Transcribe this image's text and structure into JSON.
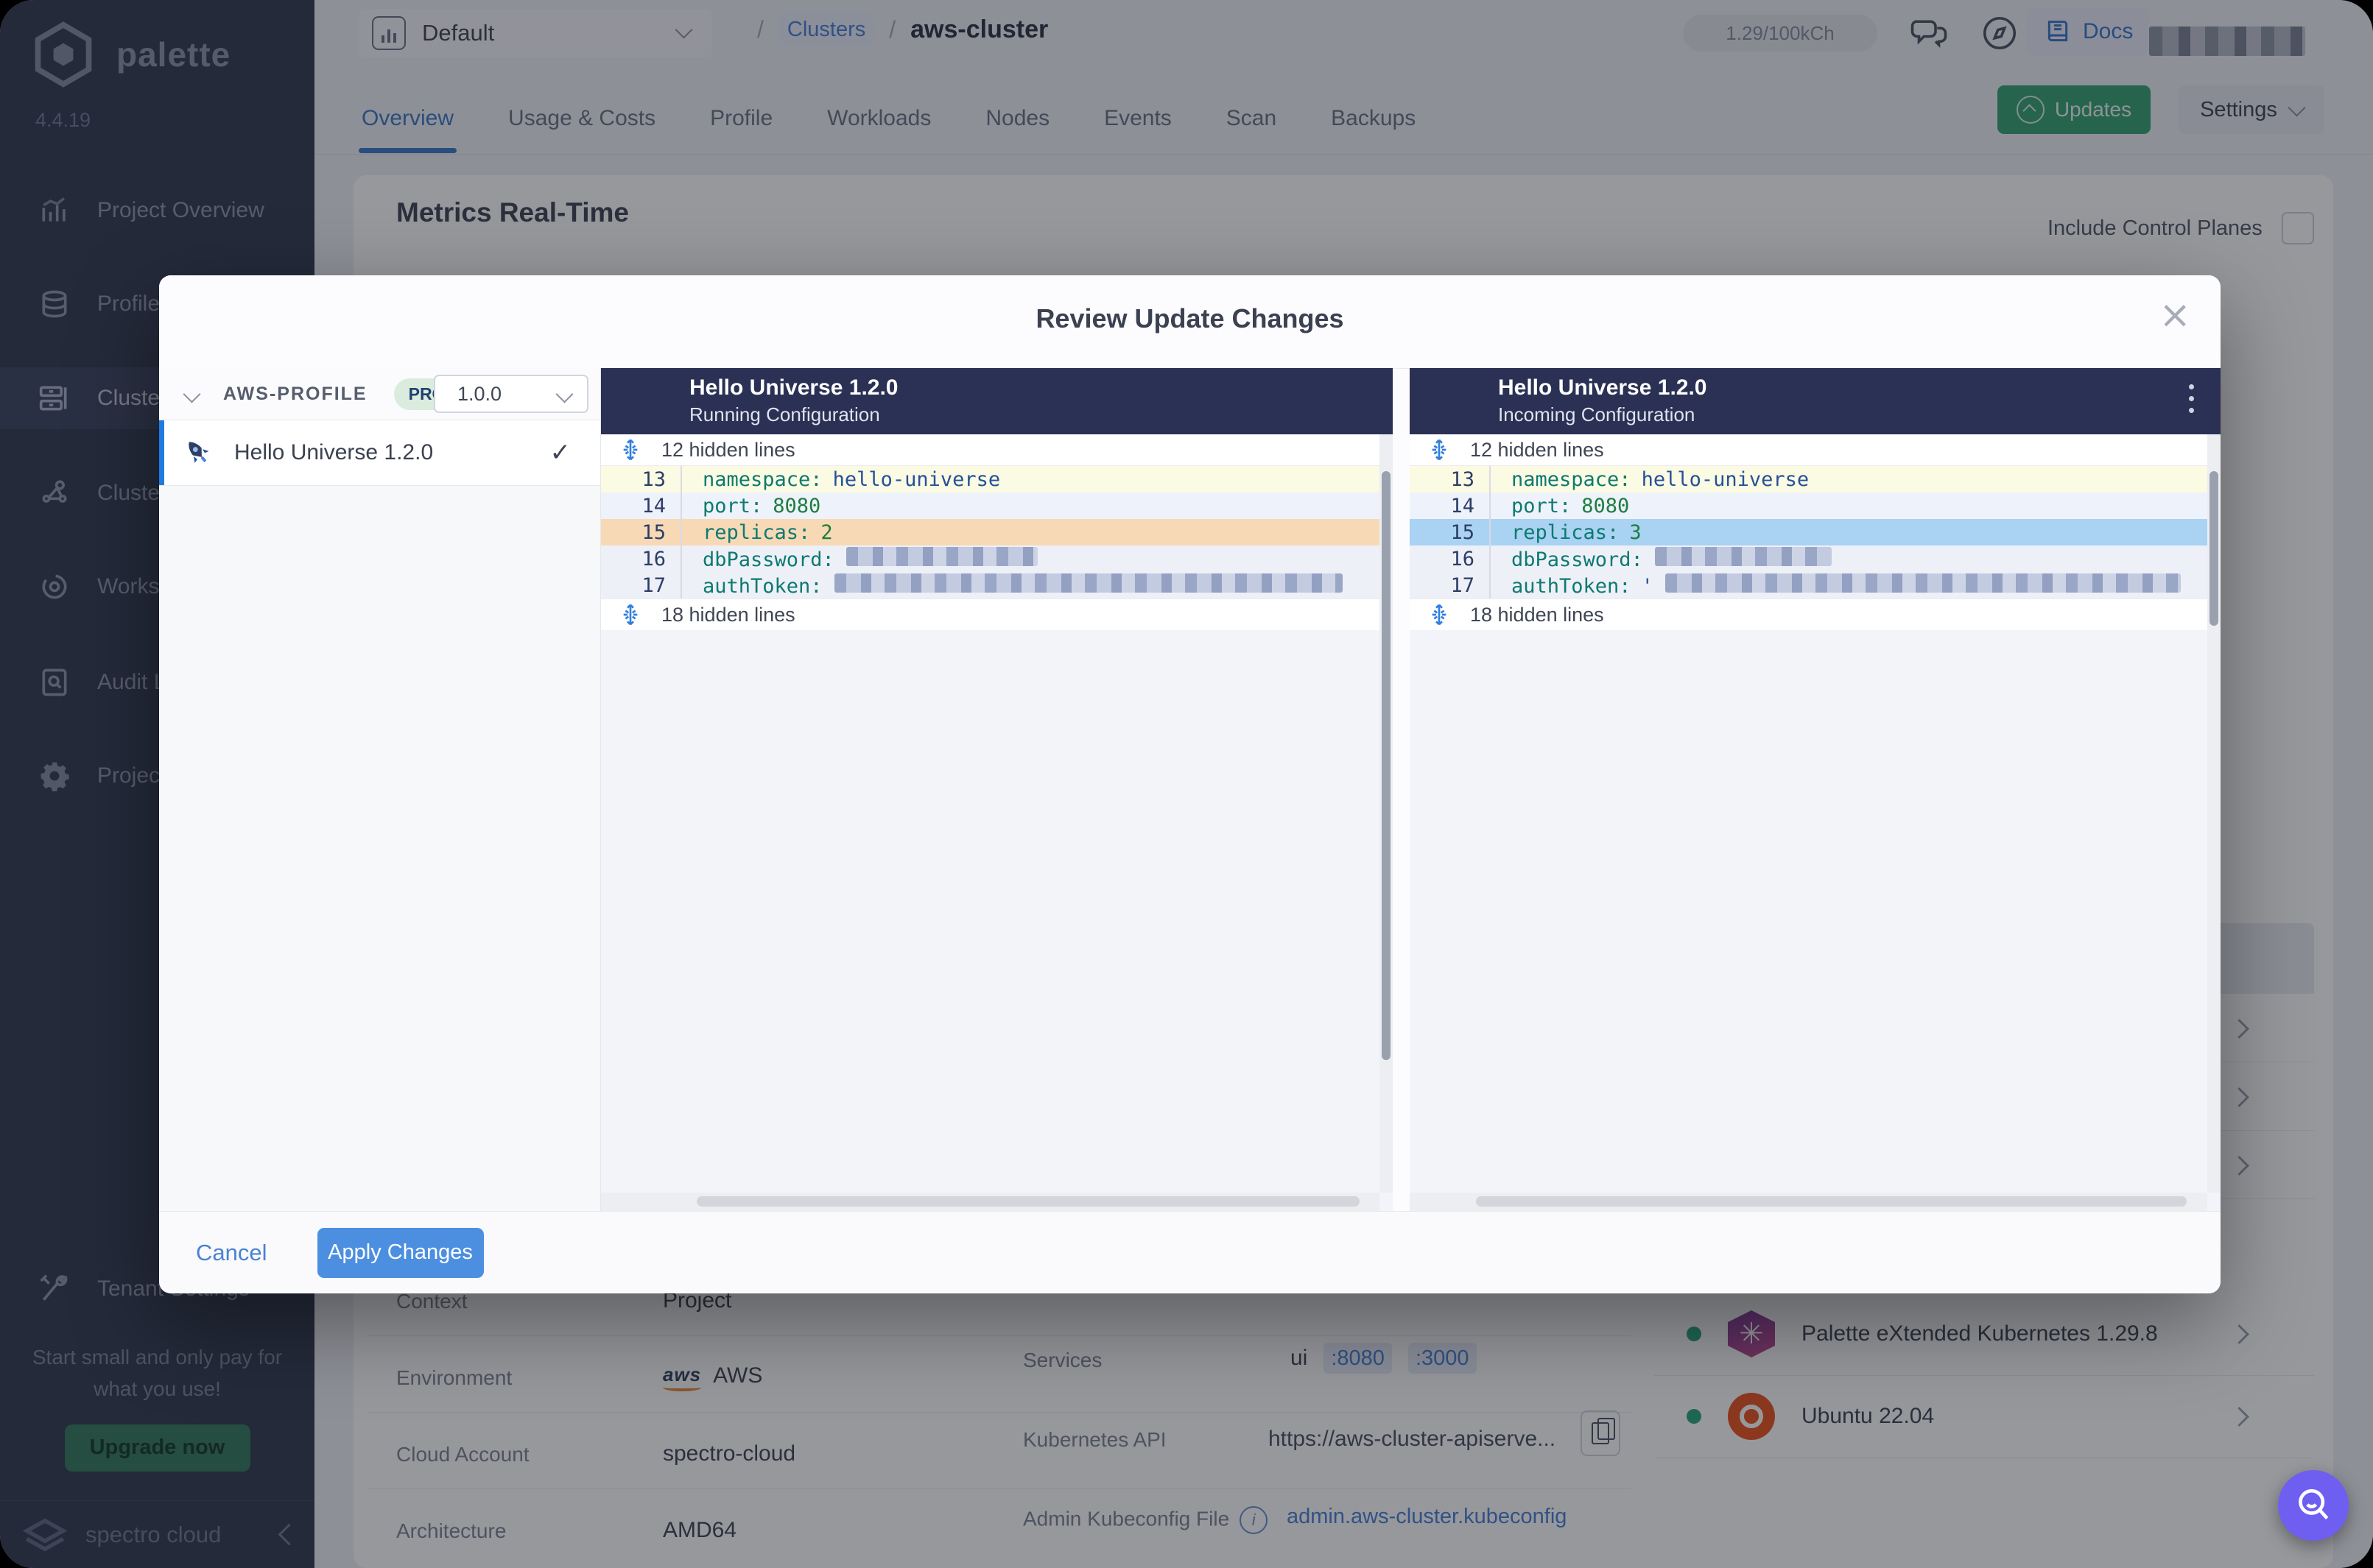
{
  "colors": {
    "accent_blue": "#4a80d8",
    "apply_blue": "#4c8fe0",
    "updates_green": "#36a375",
    "diff_header_navy": "#2b3154",
    "running_highlight": "#f8d9b6",
    "incoming_highlight": "#a9d2f3",
    "assistant_purple": "#6e5ff1",
    "sidebar_bg": "#333b50"
  },
  "sidebar": {
    "brand": "palette",
    "version": "4.4.19",
    "items": [
      {
        "label": "Project Overview",
        "icon": "chart-icon"
      },
      {
        "label": "Profiles",
        "icon": "layers-icon"
      },
      {
        "label": "Clusters",
        "icon": "server-icon"
      },
      {
        "label": "Cluster Groups",
        "icon": "network-icon"
      },
      {
        "label": "Workspaces",
        "icon": "orbit-icon"
      },
      {
        "label": "Audit Logs",
        "icon": "audit-icon"
      },
      {
        "label": "Project Settings",
        "icon": "gear-icon"
      },
      {
        "label": "Tenant Settings",
        "icon": "tools-icon"
      }
    ],
    "upsell_text": "Start small and only pay for what you use!",
    "upgrade_label": "Upgrade now",
    "footer_brand": "spectro cloud"
  },
  "topbar": {
    "project": "Default",
    "breadcrumb_sep": "/",
    "breadcrumb_link": "Clusters",
    "breadcrumb_current": "aws-cluster",
    "credits": "1.29/100kCh",
    "docs_label": "Docs"
  },
  "tabs": {
    "items": [
      {
        "label": "Overview"
      },
      {
        "label": "Usage & Costs"
      },
      {
        "label": "Profile"
      },
      {
        "label": "Workloads"
      },
      {
        "label": "Nodes"
      },
      {
        "label": "Events"
      },
      {
        "label": "Scan"
      },
      {
        "label": "Backups"
      }
    ],
    "active": "Overview"
  },
  "actions": {
    "updates": "Updates",
    "settings": "Settings"
  },
  "content": {
    "title": "Metrics Real-Time",
    "control_planes": "Include Control Planes",
    "details": [
      {
        "label": "Context",
        "value": "Project"
      },
      {
        "label": "Environment",
        "value": "AWS"
      },
      {
        "label": "Cloud Account",
        "value": "spectro-cloud"
      },
      {
        "label": "Architecture",
        "value": "AMD64"
      }
    ],
    "services": {
      "label": "Services",
      "name": "ui",
      "port1": ":8080",
      "port2": ":3000"
    },
    "k8s_api": {
      "label": "Kubernetes API",
      "value": "https://aws-cluster-apiserve..."
    },
    "kubeconfig": {
      "label": "Admin Kubeconfig File",
      "value": "admin.aws-cluster.kubeconfig"
    },
    "packs": [
      {
        "name": "Palette eXtended Kubernetes 1.29.8"
      },
      {
        "name": "Ubuntu 22.04"
      }
    ]
  },
  "modal": {
    "title": "Review Update Changes",
    "profile": {
      "name": "AWS-PROFILE",
      "scope": "PROJ",
      "version": "1.0.0",
      "item": "Hello Universe 1.2.0"
    },
    "left_pane": {
      "title": "Hello Universe 1.2.0",
      "subtitle": "Running Configuration",
      "hidden_top": "12 hidden lines",
      "hidden_bottom": "18 hidden lines",
      "lines": [
        {
          "n": "13",
          "key": "namespace:",
          "value": "hello-universe"
        },
        {
          "n": "14",
          "key": "port:",
          "value": "8080"
        },
        {
          "n": "15",
          "key": "replicas:",
          "value": "2"
        },
        {
          "n": "16",
          "key": "dbPassword:",
          "value": ""
        },
        {
          "n": "17",
          "key": "authToken:",
          "value": ""
        }
      ]
    },
    "right_pane": {
      "title": "Hello Universe 1.2.0",
      "subtitle": "Incoming Configuration",
      "hidden_top": "12 hidden lines",
      "hidden_bottom": "18 hidden lines",
      "lines": [
        {
          "n": "13",
          "key": "namespace:",
          "value": "hello-universe"
        },
        {
          "n": "14",
          "key": "port:",
          "value": "8080"
        },
        {
          "n": "15",
          "key": "replicas:",
          "value": "3"
        },
        {
          "n": "16",
          "key": "dbPassword:",
          "value": ""
        },
        {
          "n": "17",
          "key": "authToken:",
          "value": "'"
        }
      ]
    },
    "footer": {
      "cancel": "Cancel",
      "apply": "Apply Changes"
    }
  }
}
